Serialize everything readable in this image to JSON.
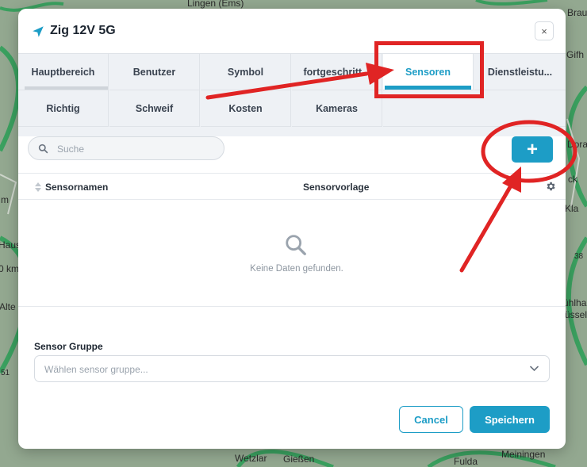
{
  "map": {
    "labels": [
      "Lingen (Ems)",
      "Wetzlar",
      "Gießen",
      "Fulda",
      "Meiningen",
      "Braun",
      "Gifh",
      "Dora",
      "Kla",
      "ühlha",
      "üssel",
      "m",
      "Haus",
      "Alte",
      "ck",
      "0 km",
      "38",
      "51"
    ]
  },
  "modal": {
    "title": "Zig 12V 5G",
    "close_label": "×"
  },
  "tabs": {
    "row1": [
      "Hauptbereich",
      "Benutzer",
      "Symbol",
      "fortgeschritt...",
      "Sensoren",
      "Dienstleistu..."
    ],
    "row2": [
      "Richtig",
      "Schweif",
      "Kosten",
      "Kameras"
    ],
    "active": "Sensoren"
  },
  "search": {
    "placeholder": "Suche"
  },
  "add_button": {
    "label": "+"
  },
  "table": {
    "columns": [
      "Sensornamen",
      "Sensorvorlage"
    ],
    "empty_text": "Keine Daten gefunden."
  },
  "sensor_group": {
    "label": "Sensor Gruppe",
    "placeholder": "Wählen sensor gruppe..."
  },
  "footer": {
    "cancel": "Cancel",
    "save": "Speichern"
  },
  "colors": {
    "accent": "#1d9dc6",
    "annotation": "#e02424"
  },
  "icons": {
    "title": "navigation-arrow-icon",
    "close": "close-icon",
    "search": "search-icon",
    "sort": "sort-icon",
    "settings": "gear-icon",
    "empty": "search-icon",
    "select": "chevron-down-icon"
  }
}
